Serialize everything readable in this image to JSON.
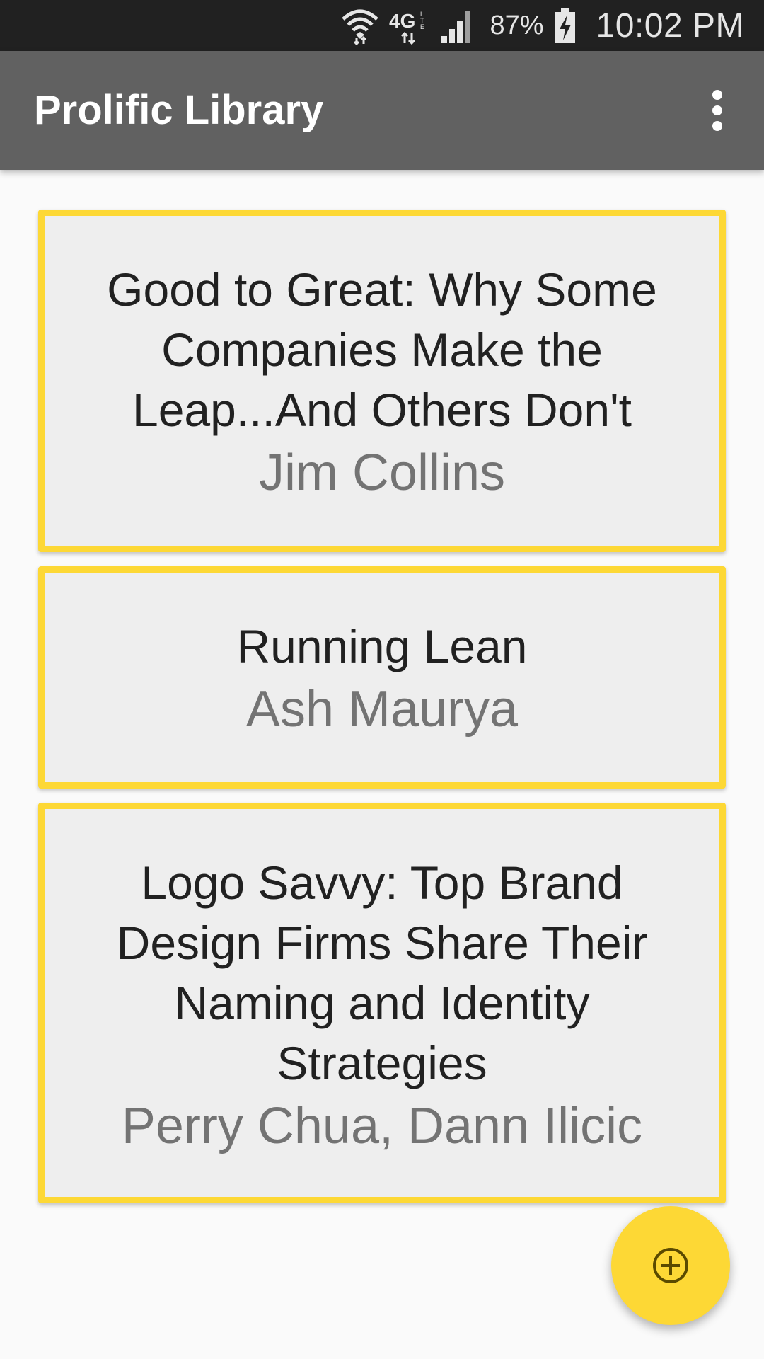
{
  "status_bar": {
    "icons": [
      "wifi-icon",
      "lte-4g-icon",
      "signal-icon",
      "battery-charging-icon"
    ],
    "network_label": "4G",
    "battery_percent": "87%",
    "time": "10:02 PM"
  },
  "app_bar": {
    "title": "Prolific Library",
    "menu_icon": "more-vert-icon"
  },
  "books": [
    {
      "title": "Good to Great: Why Some Companies Make the Leap...And Others Don't",
      "author": "Jim Collins"
    },
    {
      "title": "Running Lean",
      "author": "Ash Maurya"
    },
    {
      "title": "Logo Savvy: Top Brand Design Firms Share Their Naming and Identity Strategies",
      "author": "Perry Chua, Dann Ilicic"
    }
  ],
  "fab": {
    "icon": "add-circle-icon"
  },
  "colors": {
    "status_bar": "#212121",
    "app_bar": "#616161",
    "accent": "#fdd835",
    "card_background": "#eeeeee",
    "title_text": "#212121",
    "author_text": "#737373"
  }
}
